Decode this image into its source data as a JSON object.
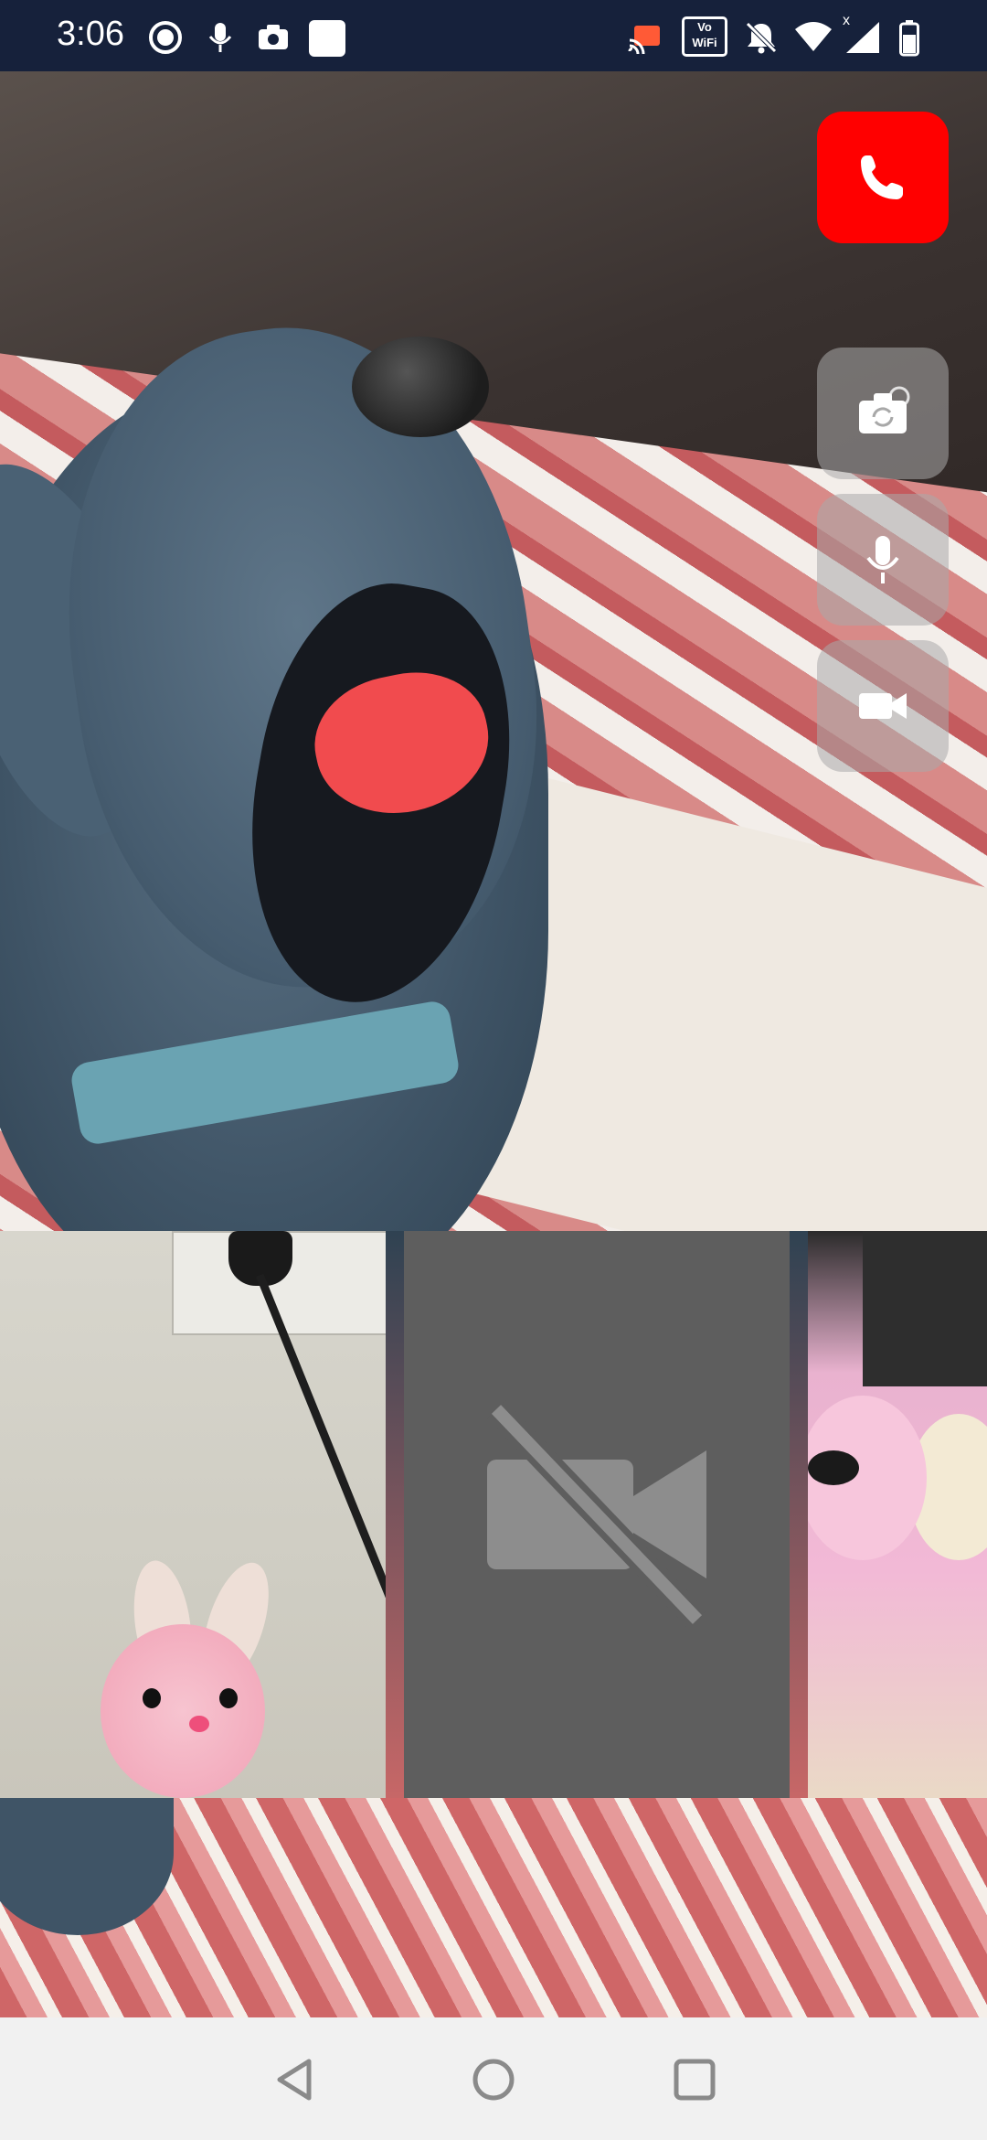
{
  "status_bar": {
    "time": "3:06",
    "left_icons": [
      "record-icon",
      "mic-icon",
      "camera-icon",
      "square-app-icon"
    ],
    "right_icons": [
      "cast-icon",
      "vowifi-icon",
      "bell-off-icon",
      "wifi-icon",
      "signal-icon",
      "battery-icon"
    ],
    "vowifi_top": "Vo",
    "vowifi_bottom": "WiFi",
    "signal_marker": "x"
  },
  "call": {
    "controls": [
      {
        "name": "end-call-button",
        "icon": "phone-icon",
        "color": "#ff0000"
      },
      {
        "name": "switch-camera-button",
        "icon": "camera-flip-icon"
      },
      {
        "name": "microphone-button",
        "icon": "mic-icon"
      },
      {
        "name": "video-button",
        "icon": "video-icon"
      }
    ],
    "participants": [
      {
        "name": "participant-thumb-1",
        "video": "on"
      },
      {
        "name": "participant-thumb-2",
        "video": "off",
        "icon": "video-off-icon"
      },
      {
        "name": "participant-thumb-3",
        "video": "on"
      }
    ]
  },
  "nav_bar": {
    "buttons": [
      "back-icon",
      "home-icon",
      "recents-icon"
    ]
  }
}
